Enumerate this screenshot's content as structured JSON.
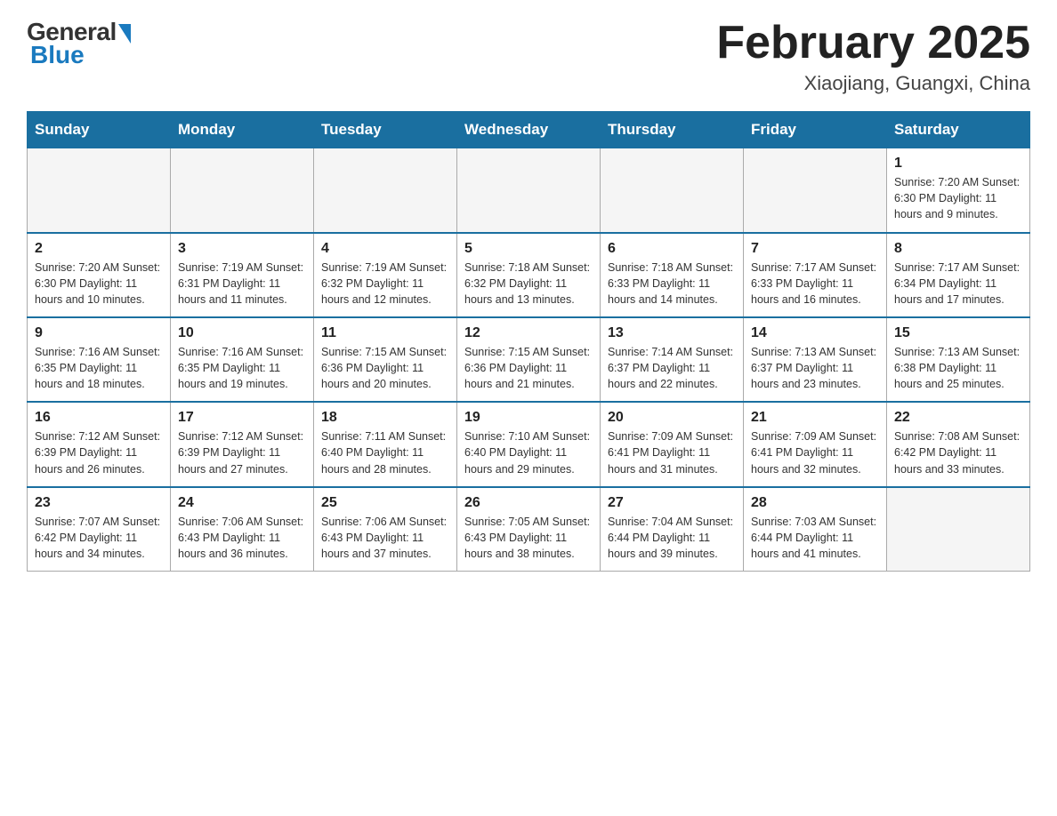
{
  "header": {
    "logo_general": "General",
    "logo_blue": "Blue",
    "title": "February 2025",
    "subtitle": "Xiaojiang, Guangxi, China"
  },
  "weekdays": [
    "Sunday",
    "Monday",
    "Tuesday",
    "Wednesday",
    "Thursday",
    "Friday",
    "Saturday"
  ],
  "weeks": [
    [
      {
        "day": "",
        "info": ""
      },
      {
        "day": "",
        "info": ""
      },
      {
        "day": "",
        "info": ""
      },
      {
        "day": "",
        "info": ""
      },
      {
        "day": "",
        "info": ""
      },
      {
        "day": "",
        "info": ""
      },
      {
        "day": "1",
        "info": "Sunrise: 7:20 AM\nSunset: 6:30 PM\nDaylight: 11 hours and 9 minutes."
      }
    ],
    [
      {
        "day": "2",
        "info": "Sunrise: 7:20 AM\nSunset: 6:30 PM\nDaylight: 11 hours and 10 minutes."
      },
      {
        "day": "3",
        "info": "Sunrise: 7:19 AM\nSunset: 6:31 PM\nDaylight: 11 hours and 11 minutes."
      },
      {
        "day": "4",
        "info": "Sunrise: 7:19 AM\nSunset: 6:32 PM\nDaylight: 11 hours and 12 minutes."
      },
      {
        "day": "5",
        "info": "Sunrise: 7:18 AM\nSunset: 6:32 PM\nDaylight: 11 hours and 13 minutes."
      },
      {
        "day": "6",
        "info": "Sunrise: 7:18 AM\nSunset: 6:33 PM\nDaylight: 11 hours and 14 minutes."
      },
      {
        "day": "7",
        "info": "Sunrise: 7:17 AM\nSunset: 6:33 PM\nDaylight: 11 hours and 16 minutes."
      },
      {
        "day": "8",
        "info": "Sunrise: 7:17 AM\nSunset: 6:34 PM\nDaylight: 11 hours and 17 minutes."
      }
    ],
    [
      {
        "day": "9",
        "info": "Sunrise: 7:16 AM\nSunset: 6:35 PM\nDaylight: 11 hours and 18 minutes."
      },
      {
        "day": "10",
        "info": "Sunrise: 7:16 AM\nSunset: 6:35 PM\nDaylight: 11 hours and 19 minutes."
      },
      {
        "day": "11",
        "info": "Sunrise: 7:15 AM\nSunset: 6:36 PM\nDaylight: 11 hours and 20 minutes."
      },
      {
        "day": "12",
        "info": "Sunrise: 7:15 AM\nSunset: 6:36 PM\nDaylight: 11 hours and 21 minutes."
      },
      {
        "day": "13",
        "info": "Sunrise: 7:14 AM\nSunset: 6:37 PM\nDaylight: 11 hours and 22 minutes."
      },
      {
        "day": "14",
        "info": "Sunrise: 7:13 AM\nSunset: 6:37 PM\nDaylight: 11 hours and 23 minutes."
      },
      {
        "day": "15",
        "info": "Sunrise: 7:13 AM\nSunset: 6:38 PM\nDaylight: 11 hours and 25 minutes."
      }
    ],
    [
      {
        "day": "16",
        "info": "Sunrise: 7:12 AM\nSunset: 6:39 PM\nDaylight: 11 hours and 26 minutes."
      },
      {
        "day": "17",
        "info": "Sunrise: 7:12 AM\nSunset: 6:39 PM\nDaylight: 11 hours and 27 minutes."
      },
      {
        "day": "18",
        "info": "Sunrise: 7:11 AM\nSunset: 6:40 PM\nDaylight: 11 hours and 28 minutes."
      },
      {
        "day": "19",
        "info": "Sunrise: 7:10 AM\nSunset: 6:40 PM\nDaylight: 11 hours and 29 minutes."
      },
      {
        "day": "20",
        "info": "Sunrise: 7:09 AM\nSunset: 6:41 PM\nDaylight: 11 hours and 31 minutes."
      },
      {
        "day": "21",
        "info": "Sunrise: 7:09 AM\nSunset: 6:41 PM\nDaylight: 11 hours and 32 minutes."
      },
      {
        "day": "22",
        "info": "Sunrise: 7:08 AM\nSunset: 6:42 PM\nDaylight: 11 hours and 33 minutes."
      }
    ],
    [
      {
        "day": "23",
        "info": "Sunrise: 7:07 AM\nSunset: 6:42 PM\nDaylight: 11 hours and 34 minutes."
      },
      {
        "day": "24",
        "info": "Sunrise: 7:06 AM\nSunset: 6:43 PM\nDaylight: 11 hours and 36 minutes."
      },
      {
        "day": "25",
        "info": "Sunrise: 7:06 AM\nSunset: 6:43 PM\nDaylight: 11 hours and 37 minutes."
      },
      {
        "day": "26",
        "info": "Sunrise: 7:05 AM\nSunset: 6:43 PM\nDaylight: 11 hours and 38 minutes."
      },
      {
        "day": "27",
        "info": "Sunrise: 7:04 AM\nSunset: 6:44 PM\nDaylight: 11 hours and 39 minutes."
      },
      {
        "day": "28",
        "info": "Sunrise: 7:03 AM\nSunset: 6:44 PM\nDaylight: 11 hours and 41 minutes."
      },
      {
        "day": "",
        "info": ""
      }
    ]
  ]
}
